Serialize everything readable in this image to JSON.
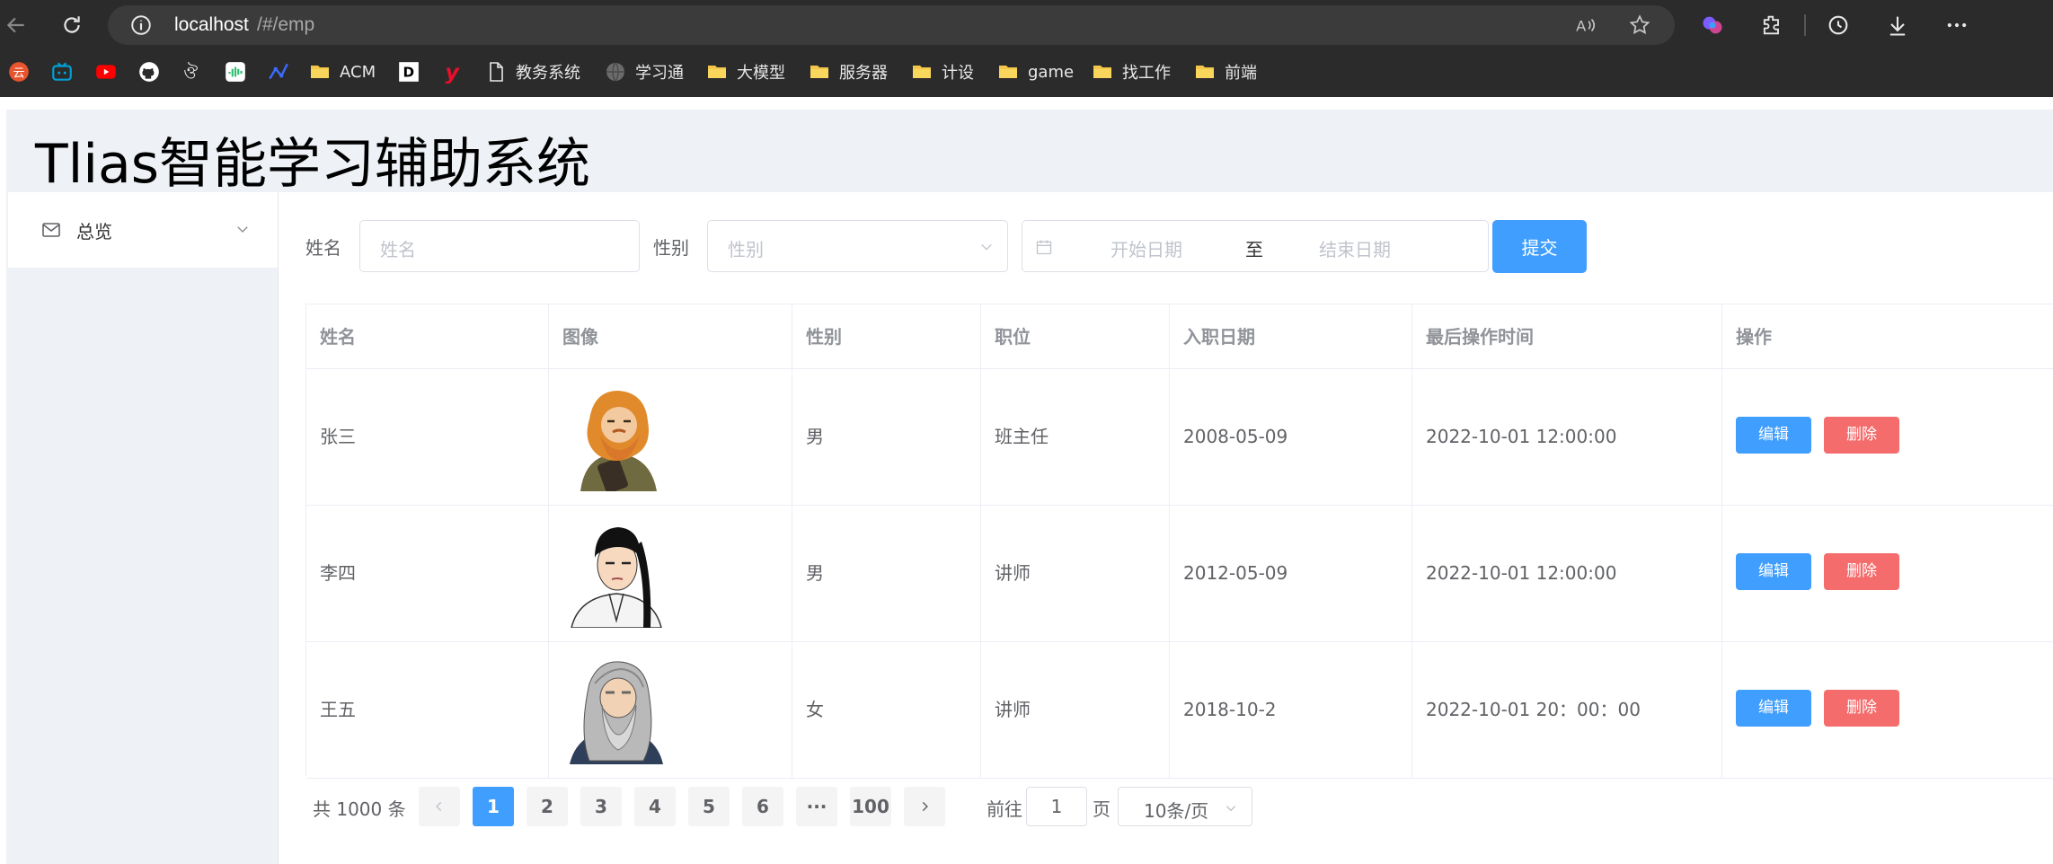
{
  "browser": {
    "url_host": "localhost",
    "url_path": "/#/emp",
    "bookmarks": [
      {
        "label": "ACM",
        "icon": "folder-icon"
      },
      {
        "label": "教务系统",
        "icon": "page-icon"
      },
      {
        "label": "学习通",
        "icon": "globe-icon"
      },
      {
        "label": "大模型",
        "icon": "folder-icon"
      },
      {
        "label": "服务器",
        "icon": "folder-icon"
      },
      {
        "label": "计设",
        "icon": "folder-icon"
      },
      {
        "label": "game",
        "icon": "folder-icon"
      },
      {
        "label": "找工作",
        "icon": "folder-icon"
      },
      {
        "label": "前端",
        "icon": "folder-icon"
      }
    ]
  },
  "app": {
    "title": "Tlias智能学习辅助系统"
  },
  "sidebar": {
    "items": [
      {
        "label": "总览",
        "icon": "mail-icon"
      }
    ]
  },
  "search": {
    "name_label": "姓名",
    "name_placeholder": "姓名",
    "gender_label": "性别",
    "gender_placeholder": "性别",
    "start_placeholder": "开始日期",
    "range_separator": "至",
    "end_placeholder": "结束日期",
    "submit_label": "提交"
  },
  "table": {
    "headers": [
      "姓名",
      "图像",
      "性别",
      "职位",
      "入职日期",
      "最后操作时间",
      "操作"
    ],
    "rows": [
      {
        "name": "张三",
        "gender": "男",
        "position": "班主任",
        "entry_date": "2008-05-09",
        "update_time": "2022-10-01 12:00:00",
        "avatar": "bearded-warrior-avatar"
      },
      {
        "name": "李四",
        "gender": "男",
        "position": "讲师",
        "entry_date": "2012-05-09",
        "update_time": "2022-10-01 12:00:00",
        "avatar": "young-swordsman-avatar"
      },
      {
        "name": "王五",
        "gender": "女",
        "position": "讲师",
        "entry_date": "2018-10-2",
        "update_time": "2022-10-01 20：00：00",
        "avatar": "old-master-avatar"
      }
    ],
    "edit_label": "编辑",
    "delete_label": "删除"
  },
  "pagination": {
    "total_text": "共 1000 条",
    "pages": [
      "1",
      "2",
      "3",
      "4",
      "5",
      "6",
      "···",
      "100"
    ],
    "current_page": "1",
    "goto_label": "前往",
    "goto_value": "1",
    "page_suffix": "页",
    "page_size": "10条/页"
  },
  "colors": {
    "primary": "#409eff",
    "danger": "#f56c6c",
    "header_bg": "#eef1f6"
  }
}
